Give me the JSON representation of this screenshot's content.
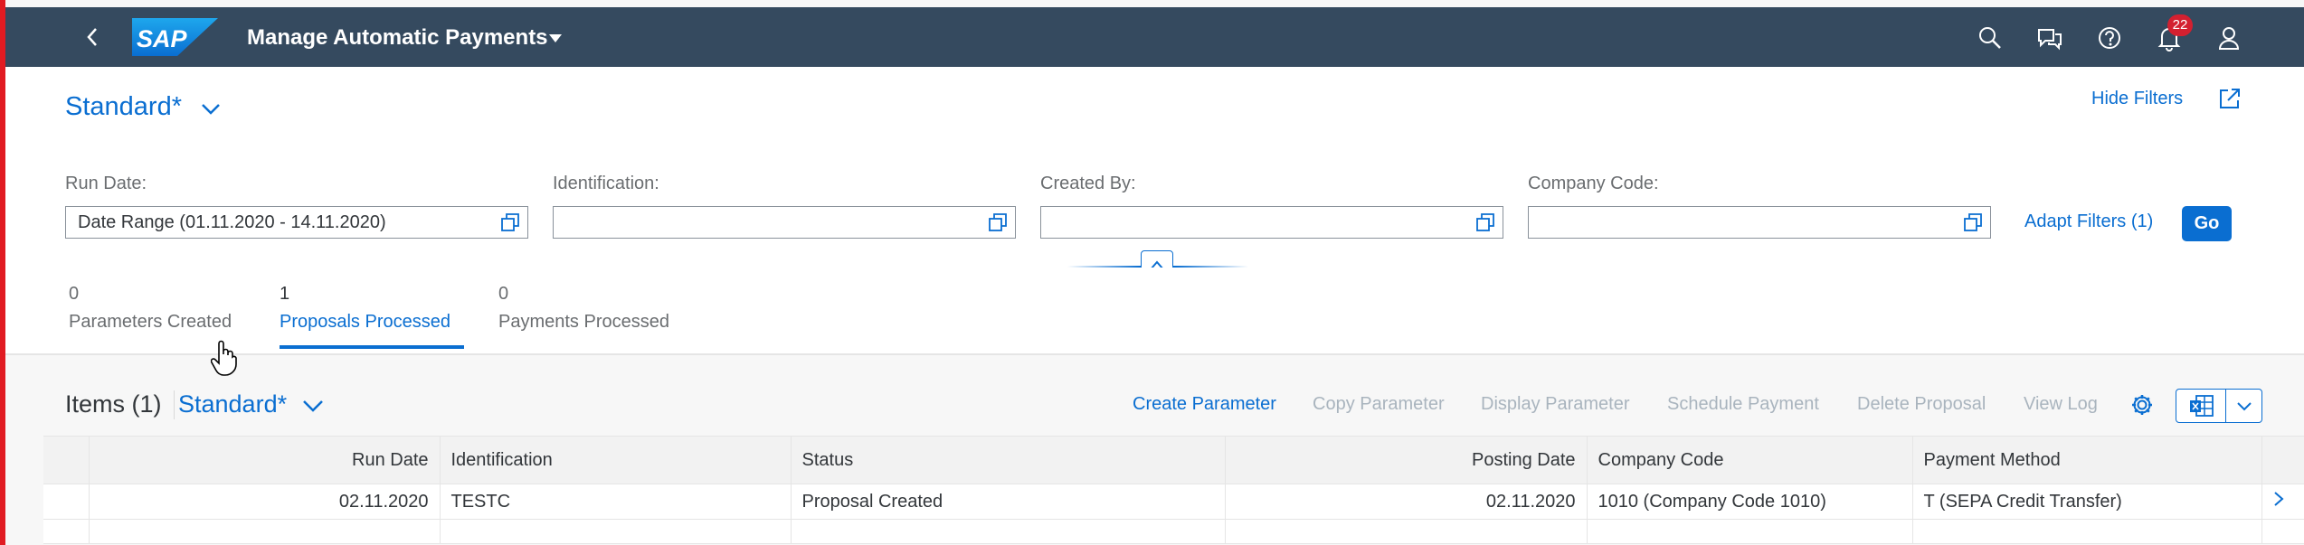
{
  "shell": {
    "logo_text": "SAP",
    "app_title": "Manage Automatic Payments",
    "notification_count": "22",
    "icons": [
      "back-icon",
      "search-icon",
      "feedback-icon",
      "help-icon",
      "bell-icon",
      "user-icon"
    ]
  },
  "header": {
    "variant": "Standard*",
    "hide_filters": "Hide Filters"
  },
  "filters": {
    "run_date_label": "Run Date:",
    "run_date_value": "Date Range (01.11.2020 - 14.11.2020)",
    "identification_label": "Identification:",
    "identification_value": "",
    "created_by_label": "Created By:",
    "created_by_value": "",
    "company_code_label": "Company Code:",
    "company_code_value": "",
    "adapt_filters": "Adapt Filters (1)",
    "go": "Go"
  },
  "tabs": [
    {
      "count": "0",
      "label": "Parameters Created",
      "active": false
    },
    {
      "count": "1",
      "label": "Proposals Processed",
      "active": true
    },
    {
      "count": "0",
      "label": "Payments Processed",
      "active": false
    }
  ],
  "table_toolbar": {
    "items_title": "Items (1)",
    "variant": "Standard*",
    "buttons": [
      {
        "label": "Create Parameter",
        "enabled": true
      },
      {
        "label": "Copy Parameter",
        "enabled": false
      },
      {
        "label": "Display Parameter",
        "enabled": false
      },
      {
        "label": "Schedule Payment",
        "enabled": false
      },
      {
        "label": "Delete Proposal",
        "enabled": false
      },
      {
        "label": "View Log",
        "enabled": false
      }
    ]
  },
  "table": {
    "columns": [
      "Run Date",
      "Identification",
      "Status",
      "Posting Date",
      "Company Code",
      "Payment Method"
    ],
    "rows": [
      {
        "run_date": "02.11.2020",
        "identification": "TESTC",
        "status": "Proposal Created",
        "posting_date": "02.11.2020",
        "company_code": "1010 (Company Code 1010)",
        "payment_method": "T (SEPA Credit Transfer)"
      }
    ]
  },
  "colors": {
    "shell_bg": "#354a5f",
    "accent": "#0a6ed1",
    "disabled": "#a9b4be",
    "badge": "#d32030"
  }
}
